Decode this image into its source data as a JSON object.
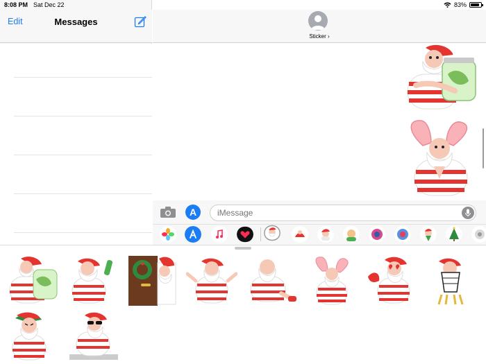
{
  "status_bar": {
    "time": "8:08 PM",
    "date": "Sat Dec 22",
    "battery": "83%",
    "battery_level": 0.83
  },
  "messages_list": {
    "edit_label": "Edit",
    "title": "Messages"
  },
  "conversation": {
    "contact_name": "Sticker ›",
    "input_placeholder": "iMessage"
  },
  "colors": {
    "accent": "#1a7df5",
    "sticker_red": "#e3342f",
    "skin": "#f6c9b6"
  },
  "icons": {
    "compose": "compose-icon",
    "camera": "camera-icon",
    "app_store": "app-store-icon",
    "mic": "microphone-icon",
    "wifi": "wifi-icon",
    "battery": "battery-icon"
  }
}
